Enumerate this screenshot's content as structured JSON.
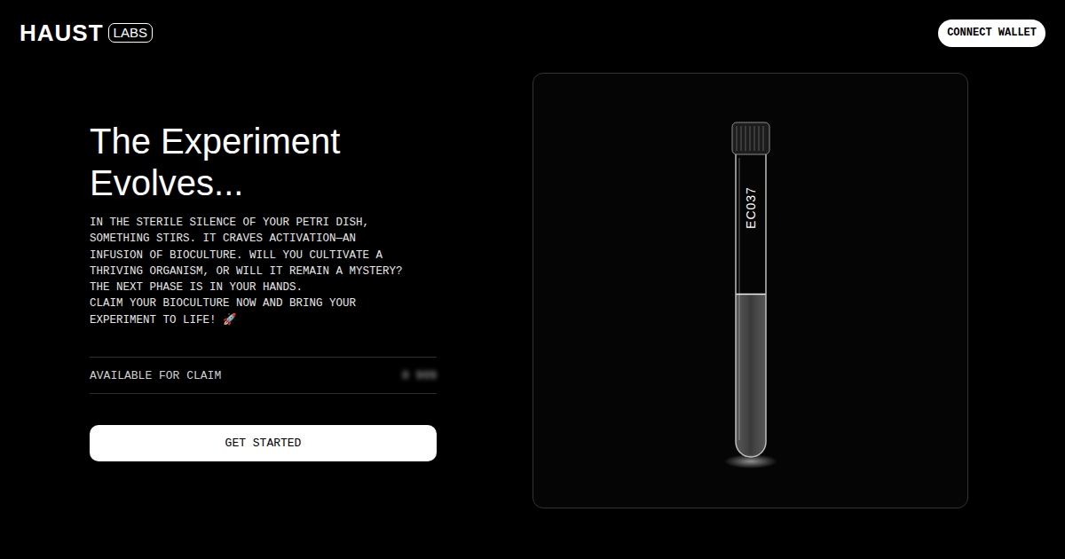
{
  "header": {
    "logo": {
      "name": "HAUST",
      "badge": "LABS"
    },
    "connect_button": "CONNECT WALLET"
  },
  "hero": {
    "title_lines": [
      "The Experiment",
      "Evolves..."
    ],
    "description_lines": [
      "IN THE STERILE SILENCE OF YOUR PETRI DISH,",
      "SOMETHING STIRS. IT CRAVES ACTIVATION—AN",
      "INFUSION OF BIOCULTURE. WILL YOU CULTIVATE A",
      "THRIVING ORGANISM, OR WILL IT REMAIN A MYSTERY?",
      "THE NEXT PHASE IS IN YOUR HANDS.",
      "CLAIM YOUR BIOCULTURE NOW AND BRING YOUR",
      "EXPERIMENT TO LIFE! 🚀"
    ],
    "claim": {
      "label": "AVAILABLE FOR CLAIM",
      "value": "0 909",
      "blurred": true
    },
    "cta": "GET STARTED"
  },
  "specimen": {
    "label": "EC037",
    "level": 0.54
  }
}
